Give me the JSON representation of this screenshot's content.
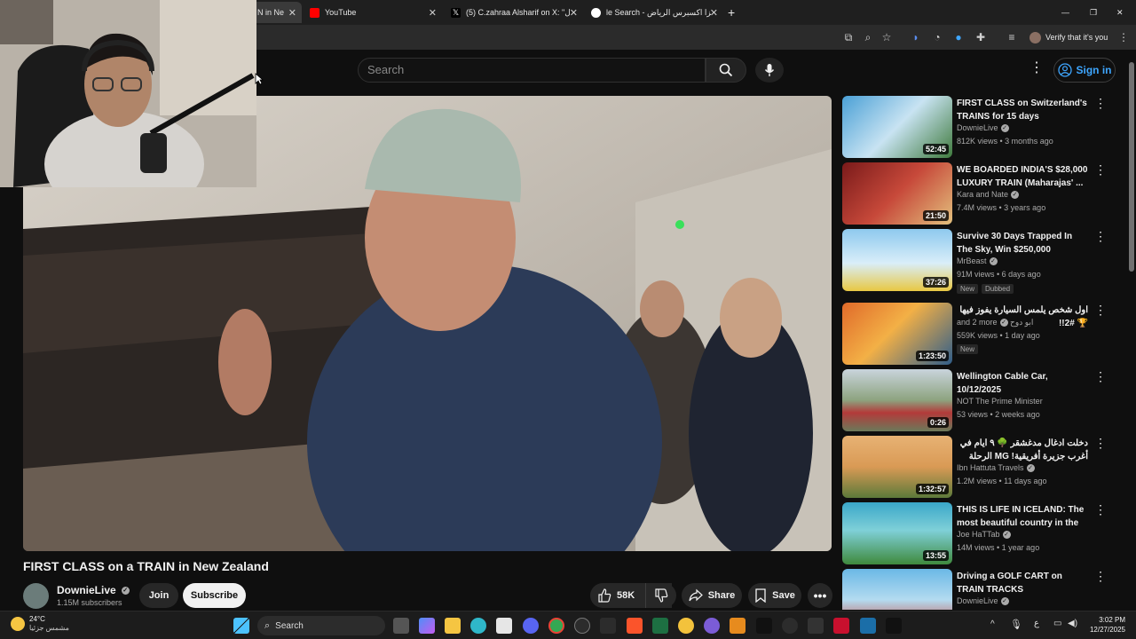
{
  "browser": {
    "tabs": [
      {
        "label": "N in Ne",
        "active": true
      },
      {
        "label": "YouTube"
      },
      {
        "label": "(5) C.zahraa Alsharif on X: \"ال..."
      },
      {
        "label": "le Search - بيتزا اكسبرس الرياض"
      }
    ],
    "new_tab": "+",
    "window_controls": {
      "minimize": "—",
      "restore": "❐",
      "close": "✕"
    },
    "verify_text": "Verify that it's you"
  },
  "youtube": {
    "search_placeholder": "Search",
    "sign_in": "Sign in"
  },
  "video": {
    "title": "FIRST CLASS on a TRAIN in New Zealand",
    "channel": "DownieLive",
    "subscribers": "1.15M subscribers",
    "join": "Join",
    "subscribe": "Subscribe",
    "likes": "58K",
    "share": "Share",
    "save": "Save"
  },
  "recommendations": [
    {
      "title": "FIRST CLASS on Switzerland's TRAINS for 15 days",
      "channel": "DownieLive",
      "meta": "812K views • 3 months ago",
      "duration": "52:45",
      "verified": true,
      "badges": []
    },
    {
      "title": "WE BOARDED INDIA'S $28,000 LUXURY TRAIN (Maharajas' ...",
      "channel": "Kara and Nate",
      "meta": "7.4M views • 3 years ago",
      "duration": "21:50",
      "verified": true,
      "badges": []
    },
    {
      "title": "Survive 30 Days Trapped In The Sky, Win $250,000",
      "channel": "MrBeast",
      "meta": "91M views • 6 days ago",
      "duration": "37:26",
      "verified": true,
      "badges": [
        "New",
        "Dubbed"
      ]
    },
    {
      "title": "اول شخص يلمس السيارة يفوز فيها 🏆 #2!!",
      "channel": "and 2 more",
      "channel_extra": "ابو دوح",
      "meta": "559K views • 1 day ago",
      "duration": "1:23:50",
      "verified": true,
      "badges": [
        "New"
      ]
    },
    {
      "title": "Wellington Cable Car, 10/12/2025",
      "channel": "NOT The Prime Minister",
      "meta": "53 views • 2 weeks ago",
      "duration": "0:26",
      "verified": false,
      "badges": []
    },
    {
      "title": "دخلت ادغال مدغشقر 🌳 ٩ ايام في أغرب جزيرة أفريقية! MG الرحلة كاملة",
      "channel": "Ibn Hattuta Travels",
      "meta": "1.2M views • 11 days ago",
      "duration": "1:32:57",
      "verified": true,
      "badges": []
    },
    {
      "title": "THIS IS LIFE IN ICELAND: The most beautiful country in the ...",
      "channel": "Joe HaTTab",
      "meta": "14M views • 1 year ago",
      "duration": "13:55",
      "verified": true,
      "badges": []
    },
    {
      "title": "Driving a GOLF CART on TRAIN TRACKS",
      "channel": "DownieLive",
      "meta": "",
      "duration": "",
      "verified": true,
      "badges": []
    }
  ],
  "taskbar": {
    "weather_temp": "24°C",
    "weather_desc": "مشمس جزئيا",
    "search_label": "Search",
    "lang": "ع",
    "time": "3:02 PM",
    "date": "12/27/2025"
  },
  "colors": {
    "background": "#0f0f0f",
    "link_blue": "#3ea6ff",
    "youtube_red": "#ff0000"
  }
}
